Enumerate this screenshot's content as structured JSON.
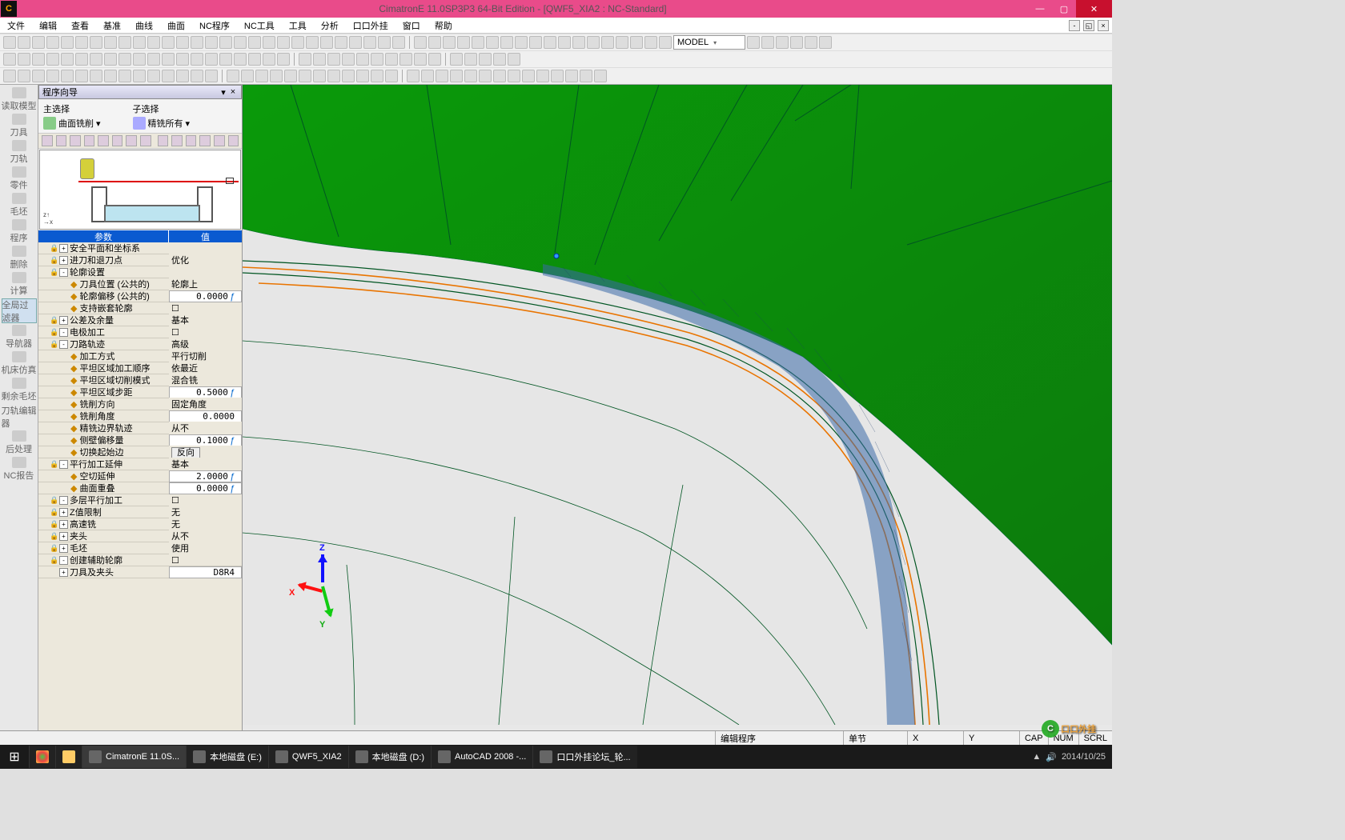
{
  "title": "CimatronE 11.0SP3P3 64-Bit Edition - [QWF5_XIA2 : NC-Standard]",
  "menus": [
    "文件",
    "编辑",
    "查看",
    "基准",
    "曲线",
    "曲面",
    "NC程序",
    "NC工具",
    "工具",
    "分析",
    "口口外挂",
    "窗口",
    "帮助"
  ],
  "model_combo": "MODEL",
  "vtabs": [
    {
      "label": "读取模型"
    },
    {
      "label": "刀具"
    },
    {
      "label": "刀轨"
    },
    {
      "label": "零件"
    },
    {
      "label": "毛坯"
    },
    {
      "label": "程序"
    },
    {
      "label": "删除"
    },
    {
      "label": "计算"
    },
    {
      "label": "全局过滤器",
      "active": true
    },
    {
      "label": "导航器"
    },
    {
      "label": "机床仿真"
    },
    {
      "label": "剩余毛坯"
    },
    {
      "label": "刀轨编辑器"
    },
    {
      "label": "后处理"
    },
    {
      "label": "NC报告"
    }
  ],
  "wizard": {
    "title": "程序向导",
    "mainsel_label": "主选择",
    "mainsel_value": "曲面铣削",
    "subsel_label": "子选择",
    "subsel_value": "精铣所有"
  },
  "param_header": {
    "col1": "参数",
    "col2": "值"
  },
  "params": [
    {
      "ind": 0,
      "exp": "+",
      "lock": 1,
      "name": "安全平面和坐标系",
      "val": ""
    },
    {
      "ind": 0,
      "exp": "+",
      "lock": 1,
      "name": "进刀和退刀点",
      "val": "优化"
    },
    {
      "ind": 0,
      "exp": "-",
      "lock": 1,
      "name": "轮廓设置",
      "val": ""
    },
    {
      "ind": 1,
      "bullet": 1,
      "name": "刀具位置 (公共的)",
      "val": "轮廓上"
    },
    {
      "ind": 1,
      "bullet": 1,
      "name": "轮廓偏移 (公共的)",
      "val": "0.0000",
      "fx": 1,
      "input": 1
    },
    {
      "ind": 1,
      "bullet": 1,
      "name": "支持嵌套轮廓",
      "val": "",
      "chk": 1
    },
    {
      "ind": 0,
      "exp": "+",
      "lock": 1,
      "name": "公差及余量",
      "val": "基本"
    },
    {
      "ind": 0,
      "exp": "-",
      "lock": 1,
      "name": "电极加工",
      "val": "",
      "chk": 1
    },
    {
      "ind": 0,
      "exp": "-",
      "lock": 1,
      "name": "刀路轨迹",
      "val": "高级"
    },
    {
      "ind": 1,
      "bullet": 1,
      "name": "加工方式",
      "val": "平行切削"
    },
    {
      "ind": 1,
      "bullet": 1,
      "name": "平坦区域加工顺序",
      "val": "依最近"
    },
    {
      "ind": 1,
      "bullet": 1,
      "name": "平坦区域切削模式",
      "val": "混合铣"
    },
    {
      "ind": 1,
      "bullet": 1,
      "name": "平坦区域步距",
      "val": "0.5000",
      "fx": 1,
      "input": 1
    },
    {
      "ind": 1,
      "bullet": 1,
      "name": "铣削方向",
      "val": "固定角度"
    },
    {
      "ind": 1,
      "bullet": 1,
      "name": "铣削角度",
      "val": "0.0000",
      "input": 1
    },
    {
      "ind": 1,
      "bullet": 1,
      "name": "精铣边界轨迹",
      "val": "从不"
    },
    {
      "ind": 1,
      "bullet": 1,
      "name": "侧壁偏移量",
      "val": "0.1000",
      "fx": 1,
      "input": 1
    },
    {
      "ind": 1,
      "bullet": 1,
      "name": "切换起始边",
      "val": "反向",
      "btn": 1
    },
    {
      "ind": 0,
      "exp": "-",
      "lock": 1,
      "name": "平行加工延伸",
      "val": "基本"
    },
    {
      "ind": 1,
      "bullet": 1,
      "name": "空切延伸",
      "val": "2.0000",
      "fx": 1,
      "input": 1
    },
    {
      "ind": 1,
      "bullet": 1,
      "name": "曲面重叠",
      "val": "0.0000",
      "fx": 1,
      "input": 1
    },
    {
      "ind": 0,
      "exp": "-",
      "lock": 1,
      "name": "多层平行加工",
      "val": "",
      "chk": 1
    },
    {
      "ind": 0,
      "exp": "+",
      "lock": 1,
      "name": "Z值限制",
      "val": "无"
    },
    {
      "ind": 0,
      "exp": "+",
      "lock": 1,
      "name": "高速铣",
      "val": "无"
    },
    {
      "ind": 0,
      "exp": "+",
      "lock": 1,
      "name": "夹头",
      "val": "从不"
    },
    {
      "ind": 0,
      "exp": "+",
      "lock": 1,
      "name": "毛坯",
      "val": "使用"
    },
    {
      "ind": 0,
      "exp": "-",
      "lock": 1,
      "name": "创建辅助轮廓",
      "val": "",
      "chk": 1
    },
    {
      "ind": 0,
      "exp": "+",
      "name": "刀具及夹头",
      "val": "D8R4",
      "input": 1
    }
  ],
  "gizmo": {
    "x": "X",
    "y": "Y",
    "z": "Z"
  },
  "status": {
    "mode": "编辑程序",
    "unit": "单节",
    "x": "X",
    "y": "Y",
    "cap": "CAP",
    "num": "NUM",
    "scrl": "SCRL"
  },
  "taskbar": {
    "items": [
      {
        "label": "CimatronE 11.0S...",
        "active": true
      },
      {
        "label": "本地磁盘 (E:)"
      },
      {
        "label": "QWF5_XIA2"
      },
      {
        "label": "本地磁盘 (D:)"
      },
      {
        "label": "AutoCAD 2008 -..."
      },
      {
        "label": "口口外挂论坛_轮..."
      }
    ],
    "date": "2014/10/25"
  },
  "watermark": "口口外挂"
}
